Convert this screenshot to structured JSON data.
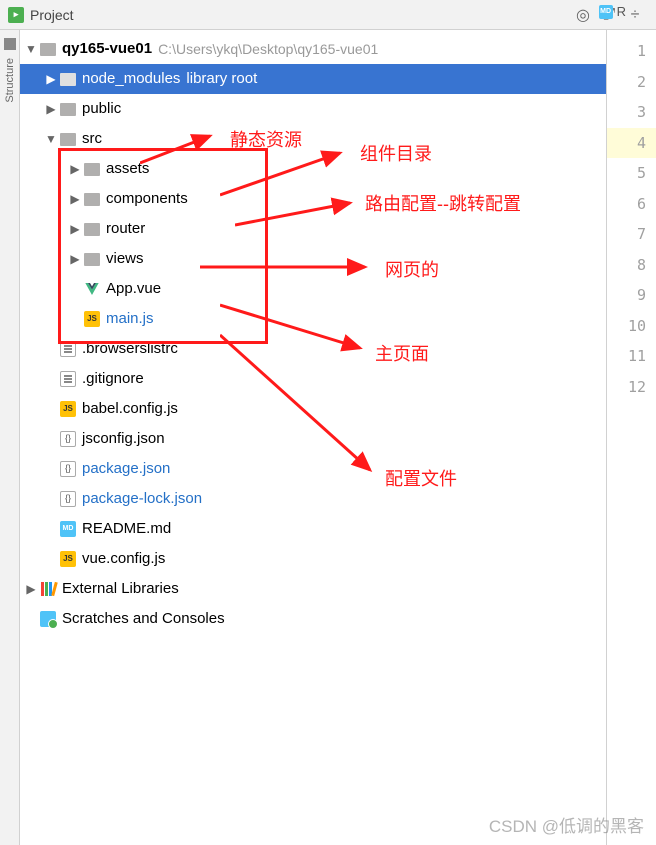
{
  "topbar": {
    "tab_label": "Project"
  },
  "editor_tab": {
    "label": "R"
  },
  "tree": {
    "root": {
      "name": "qy165-vue01",
      "path": "C:\\Users\\ykq\\Desktop\\qy165-vue01"
    },
    "node_modules": {
      "name": "node_modules",
      "suffix": "library root"
    },
    "items": [
      {
        "name": "public"
      },
      {
        "name": "src"
      },
      {
        "name": "assets"
      },
      {
        "name": "components"
      },
      {
        "name": "router"
      },
      {
        "name": "views"
      },
      {
        "name": "App.vue"
      },
      {
        "name": "main.js"
      },
      {
        "name": ".browserslistrc"
      },
      {
        "name": ".gitignore"
      },
      {
        "name": "babel.config.js"
      },
      {
        "name": "jsconfig.json"
      },
      {
        "name": "package.json"
      },
      {
        "name": "package-lock.json"
      },
      {
        "name": "README.md"
      },
      {
        "name": "vue.config.js"
      }
    ],
    "external": "External Libraries",
    "scratches": "Scratches and Consoles"
  },
  "line_numbers": [
    "1",
    "2",
    "3",
    "4",
    "5",
    "6",
    "7",
    "8",
    "9",
    "10",
    "11",
    "12"
  ],
  "annotations": {
    "a1": "静态资源",
    "a2": "组件目录",
    "a3": "路由配置--跳转配置",
    "a4": "网页的",
    "a5": "主页面",
    "a6": "配置文件"
  },
  "watermark": "CSDN @低调的黑客"
}
